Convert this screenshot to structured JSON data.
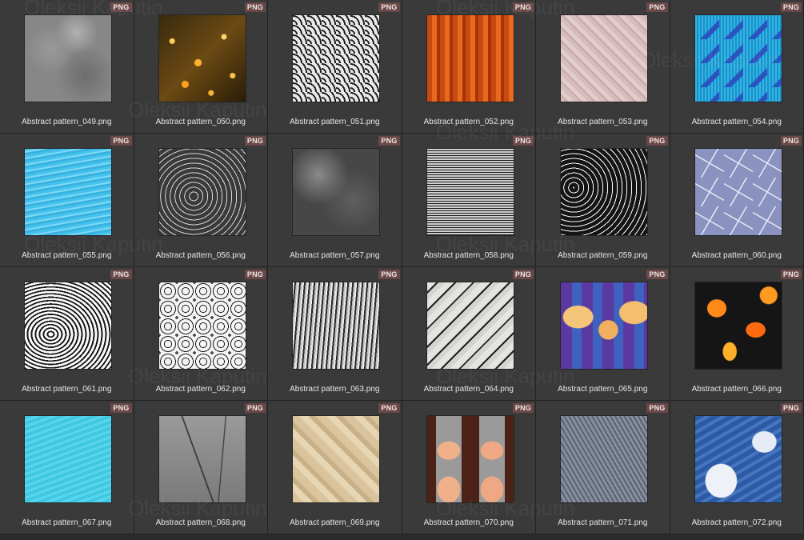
{
  "watermark": "Oleksii Kaputin",
  "badge_label": "PNG",
  "files": [
    {
      "name": "Abstract pattern_049.png"
    },
    {
      "name": "Abstract pattern_050.png"
    },
    {
      "name": "Abstract pattern_051.png"
    },
    {
      "name": "Abstract pattern_052.png"
    },
    {
      "name": "Abstract pattern_053.png"
    },
    {
      "name": "Abstract pattern_054.png"
    },
    {
      "name": "Abstract pattern_055.png"
    },
    {
      "name": "Abstract pattern_056.png"
    },
    {
      "name": "Abstract pattern_057.png"
    },
    {
      "name": "Abstract pattern_058.png"
    },
    {
      "name": "Abstract pattern_059.png"
    },
    {
      "name": "Abstract pattern_060.png"
    },
    {
      "name": "Abstract pattern_061.png"
    },
    {
      "name": "Abstract pattern_062.png"
    },
    {
      "name": "Abstract pattern_063.png"
    },
    {
      "name": "Abstract pattern_064.png"
    },
    {
      "name": "Abstract pattern_065.png"
    },
    {
      "name": "Abstract pattern_066.png"
    },
    {
      "name": "Abstract pattern_067.png"
    },
    {
      "name": "Abstract pattern_068.png"
    },
    {
      "name": "Abstract pattern_069.png"
    },
    {
      "name": "Abstract pattern_070.png"
    },
    {
      "name": "Abstract pattern_071.png"
    },
    {
      "name": "Abstract pattern_072.png"
    }
  ]
}
